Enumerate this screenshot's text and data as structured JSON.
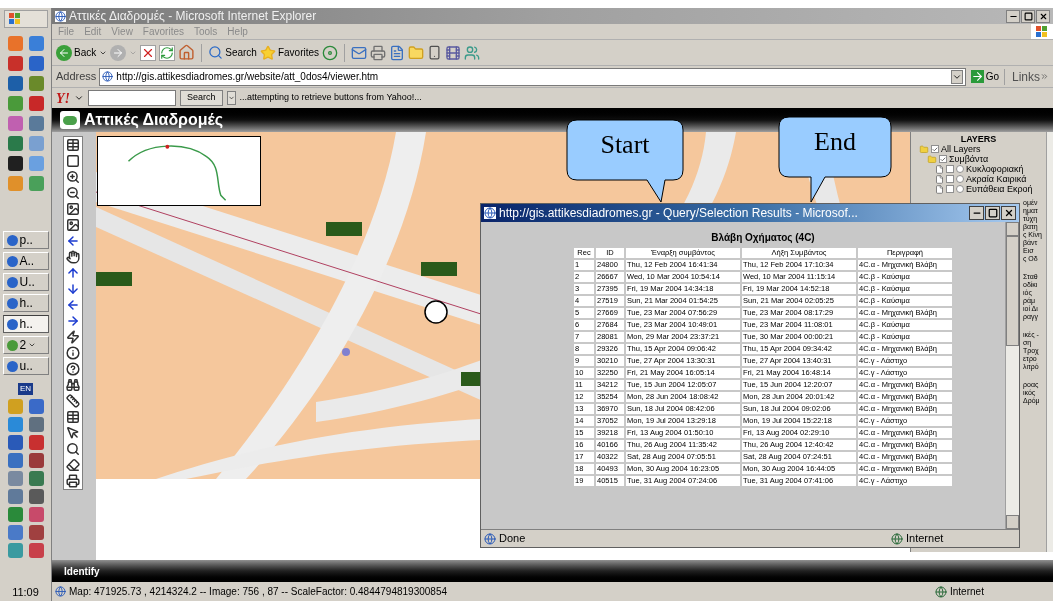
{
  "taskbar": {
    "tasks": [
      {
        "label": "p..",
        "kind": "window",
        "selected": false
      },
      {
        "label": "A..",
        "kind": "window",
        "selected": false
      },
      {
        "label": "U..",
        "kind": "window",
        "selected": false
      },
      {
        "label": "h..",
        "kind": "window",
        "selected": false
      },
      {
        "label": "h..",
        "kind": "window",
        "selected": true
      },
      {
        "label": "2",
        "kind": "group",
        "selected": false
      },
      {
        "label": "u..",
        "kind": "window",
        "selected": false
      }
    ],
    "language": "EN",
    "clock": "11:09"
  },
  "window": {
    "title": "Αττικές Διαδρομές - Microsoft Internet Explorer",
    "menu": [
      "File",
      "Edit",
      "View",
      "Favorites",
      "Tools",
      "Help"
    ],
    "toolbar": {
      "back": "Back",
      "search": "Search",
      "favorites": "Favorites"
    },
    "address": {
      "label": "Address",
      "url": "http://gis.attikesdiadromes.gr/website/att_0dos4/viewer.htm",
      "go": "Go",
      "links": "Links"
    },
    "yahoo": {
      "logo": "Y!",
      "search_button": "Search",
      "message": "...attempting to retrieve buttons from Yahoo!..."
    },
    "status": {
      "text": "Map: 471925.73 , 4214324.2 -- Image: 756 , 87 -- ScaleFactor: 0.4844794819300854",
      "zone": "Internet"
    }
  },
  "app": {
    "title": "Αττικές Διαδρομές",
    "layers": {
      "title": "LAYERS",
      "tree": [
        {
          "label": "All Layers",
          "checked": true,
          "children": [
            {
              "label": "Συμβάντα",
              "checked": true,
              "children": [
                {
                  "label": "Κυκλοφοριακή",
                  "checked": false,
                  "selected": false
                },
                {
                  "label": "Ακραία Καιρικά",
                  "checked": false,
                  "selected": false
                },
                {
                  "label": "Ευπάθεια Εκροή",
                  "checked": false,
                  "selected": false
                }
              ]
            }
          ]
        }
      ],
      "fragments": [
        [
          "ομέν",
          "ηματ",
          "τύχη",
          "βατη",
          "ς Κίνη",
          "βάντ",
          "Εισ",
          "ς Οδ"
        ],
        [
          "Σταθ",
          "οδίκι",
          "ιός",
          "ράμ",
          "ιοί Δι",
          "ραγγ"
        ],
        [
          "ικές -",
          "ση",
          "Τροχ",
          "ετρο",
          "λιτρό"
        ],
        [
          "ροας",
          "ικός",
          "Δρόμ"
        ]
      ]
    },
    "bottom_bar": "Identify"
  },
  "popup": {
    "title": "http://gis.attikesdiadromes.gr - Query/Selection Results - Microsof...",
    "heading": "Βλάβη Οχήματος (4C)",
    "columns": [
      "Rec",
      "ID",
      "Έναρξη συμβάντος",
      "Λήξη Συμβάντος",
      "Περιγραφή"
    ],
    "rows": [
      [
        "1",
        "24800",
        "Thu, 12 Feb 2004 16:41:34",
        "Thu, 12 Feb 2004 17:10:34",
        "4C.α - Μηχανική Βλάβη"
      ],
      [
        "2",
        "26667",
        "Wed, 10 Mar 2004 10:54:14",
        "Wed, 10 Mar 2004 11:15:14",
        "4C.β - Καύσιμα"
      ],
      [
        "3",
        "27395",
        "Fri, 19 Mar 2004 14:34:18",
        "Fri, 19 Mar 2004 14:52:18",
        "4C.β - Καύσιμα"
      ],
      [
        "4",
        "27519",
        "Sun, 21 Mar 2004 01:54:25",
        "Sun, 21 Mar 2004 02:05:25",
        "4C.β - Καύσιμα"
      ],
      [
        "5",
        "27669",
        "Tue, 23 Mar 2004 07:56:29",
        "Tue, 23 Mar 2004 08:17:29",
        "4C.α - Μηχανική Βλάβη"
      ],
      [
        "6",
        "27684",
        "Tue, 23 Mar 2004 10:49:01",
        "Tue, 23 Mar 2004 11:08:01",
        "4C.β - Καύσιμα"
      ],
      [
        "7",
        "28081",
        "Mon, 29 Mar 2004 23:37:21",
        "Tue, 30 Mar 2004 00:00:21",
        "4C.β - Καύσιμα"
      ],
      [
        "8",
        "29326",
        "Thu, 15 Apr 2004 09:06:42",
        "Thu, 15 Apr 2004 09:34:42",
        "4C.α - Μηχανική Βλάβη"
      ],
      [
        "9",
        "30210",
        "Tue, 27 Apr 2004 13:30:31",
        "Tue, 27 Apr 2004 13:40:31",
        "4C.γ - Λάστιχο"
      ],
      [
        "10",
        "32250",
        "Fri, 21 May 2004 16:05:14",
        "Fri, 21 May 2004 16:48:14",
        "4C.γ - Λάστιχο"
      ],
      [
        "11",
        "34212",
        "Tue, 15 Jun 2004 12:05:07",
        "Tue, 15 Jun 2004 12:20:07",
        "4C.α - Μηχανική Βλάβη"
      ],
      [
        "12",
        "35254",
        "Mon, 28 Jun 2004 18:08:42",
        "Mon, 28 Jun 2004 20:01:42",
        "4C.α - Μηχανική Βλάβη"
      ],
      [
        "13",
        "36970",
        "Sun, 18 Jul 2004 08:42:06",
        "Sun, 18 Jul 2004 09:02:06",
        "4C.α - Μηχανική Βλάβη"
      ],
      [
        "14",
        "37052",
        "Mon, 19 Jul 2004 13:29:18",
        "Mon, 19 Jul 2004 15:22:18",
        "4C.γ - Λάστιχο"
      ],
      [
        "15",
        "39218",
        "Fri, 13 Aug 2004 01:50:10",
        "Fri, 13 Aug 2004 02:29:10",
        "4C.α - Μηχανική Βλάβη"
      ],
      [
        "16",
        "40166",
        "Thu, 26 Aug 2004 11:35:42",
        "Thu, 26 Aug 2004 12:40:42",
        "4C.α - Μηχανική Βλάβη"
      ],
      [
        "17",
        "40322",
        "Sat, 28 Aug 2004 07:05:51",
        "Sat, 28 Aug 2004 07:24:51",
        "4C.α - Μηχανική Βλάβη"
      ],
      [
        "18",
        "40493",
        "Mon, 30 Aug 2004 16:23:05",
        "Mon, 30 Aug 2004 16:44:05",
        "4C.α - Μηχανική Βλάβη"
      ],
      [
        "19",
        "40515",
        "Tue, 31 Aug 2004 07:24:06",
        "Tue, 31 Aug 2004 07:41:06",
        "4C.γ - Λάστιχο"
      ]
    ],
    "status": "Done",
    "zone": "Internet"
  },
  "callouts": [
    {
      "label": "Start"
    },
    {
      "label": "End"
    }
  ]
}
